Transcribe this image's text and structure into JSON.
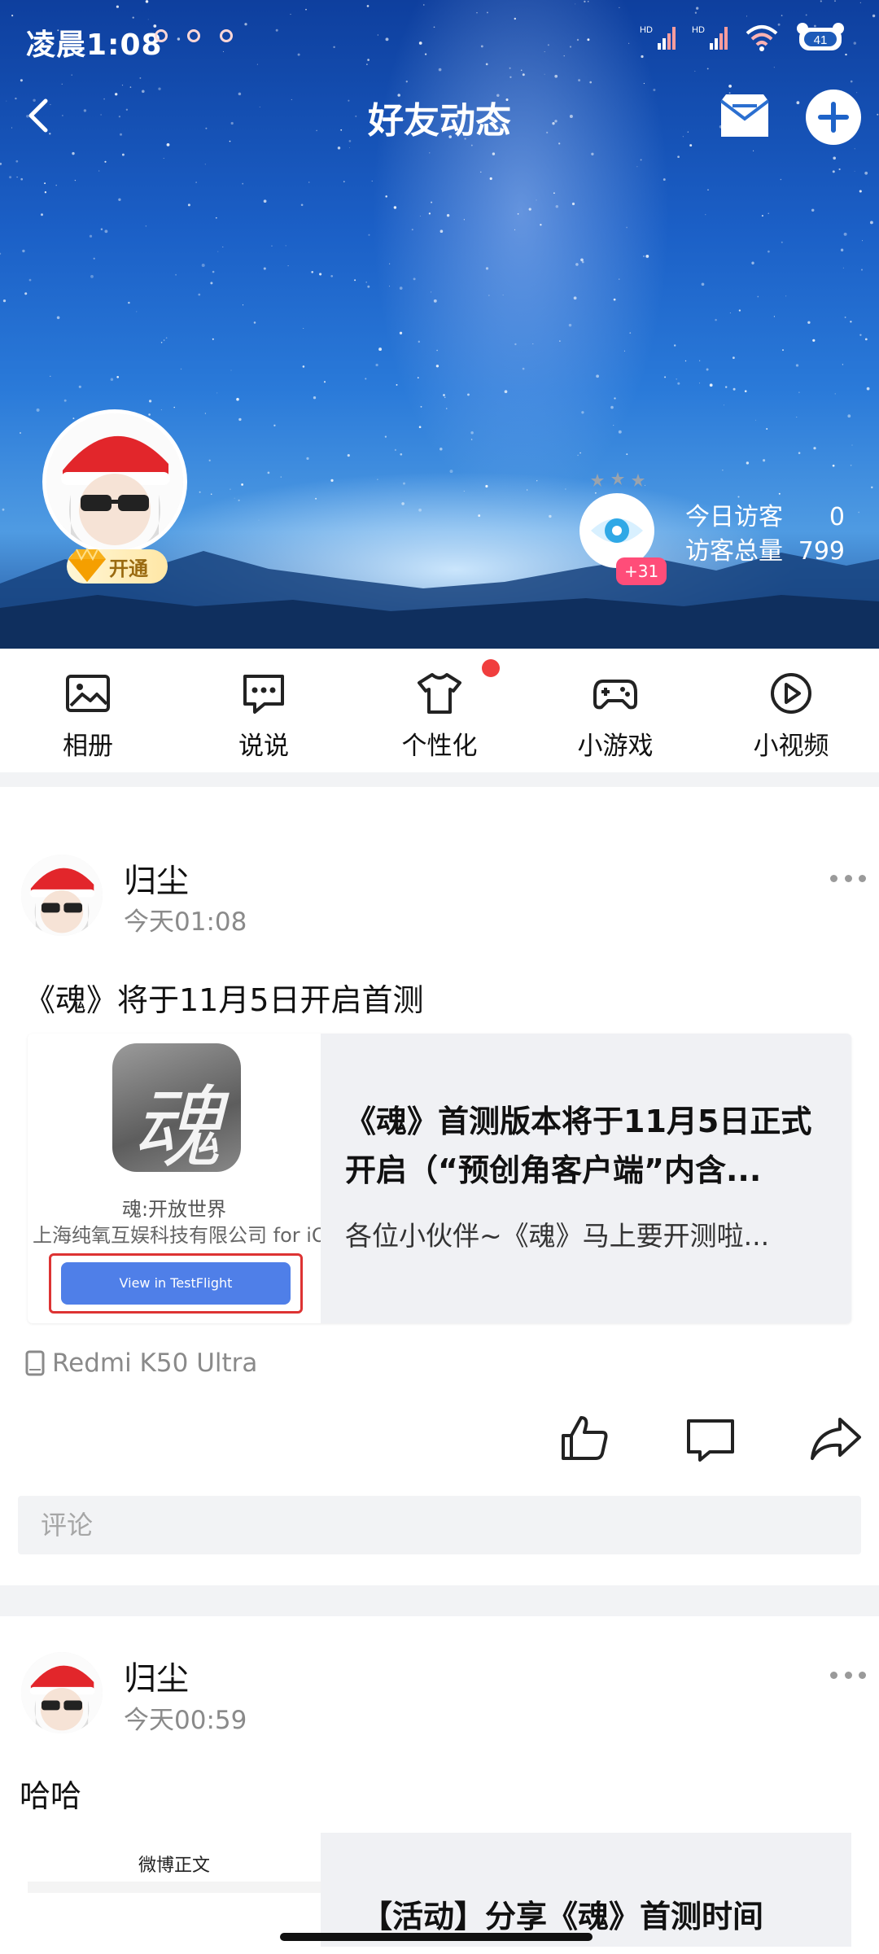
{
  "status_bar": {
    "time": "凌晨1:08",
    "signal_1_label": "HD",
    "signal_2_label": "HD",
    "battery": "41"
  },
  "header": {
    "title": "好友动态"
  },
  "profile": {
    "vip_label": "开通",
    "visitor_badge": "+31",
    "today_visitors_label": "今日访客",
    "today_visitors_value": "0",
    "total_visitors_label": "访客总量",
    "total_visitors_value": "799"
  },
  "quick_nav": [
    {
      "label": "相册",
      "icon": "photo-album-icon"
    },
    {
      "label": "说说",
      "icon": "chat-bubble-icon"
    },
    {
      "label": "个性化",
      "icon": "tshirt-icon"
    },
    {
      "label": "小游戏",
      "icon": "gamepad-icon"
    },
    {
      "label": "小视频",
      "icon": "play-circle-icon"
    }
  ],
  "posts": [
    {
      "author": "归尘",
      "time": "今天01:08",
      "text": "《魂》将于11月5日开启首测",
      "card": {
        "title": "《魂》首测版本将于11月5日正式开启（“预创角客户端”内含...",
        "description": "各位小伙伴~《魂》马上要开测啦...",
        "thumb_app_char": "魂",
        "thumb_app_name": "魂:开放世界",
        "thumb_company": "上海纯氧互娱科技有限公司 for iO",
        "thumb_button": "View in TestFlight"
      },
      "device": "Redmi K50 Ultra",
      "comment_placeholder": "评论"
    },
    {
      "author": "归尘",
      "time": "今天00:59",
      "text": "哈哈",
      "card": {
        "thumb_label": "微博正文",
        "title": "【活动】分享《魂》首测时间"
      }
    }
  ],
  "colors": {
    "accent_red": "#f03e3e",
    "badge_pink": "#ff4d79",
    "testflight_blue": "#4f7fe8"
  }
}
